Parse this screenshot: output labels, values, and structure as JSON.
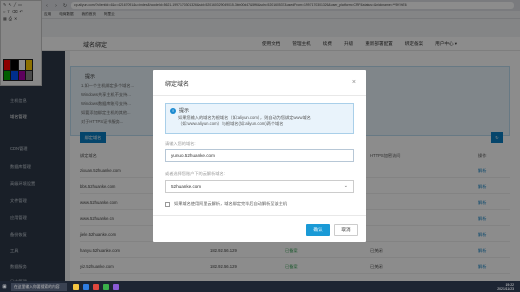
{
  "browser": {
    "url": "cp.aliyun.com/?clientId=4&c=42167091&u=index&hcodeId=5621-1997170301326&sid=520160329049015-3bb00d47&5ff6&sdn=520160537&usedFrom=1997170301326&user_platform=CRP&status=&nickname=**9K%E6",
    "bookmarks": [
      "应用",
      "电商数据",
      "我的首页",
      "阿里云"
    ]
  },
  "app": {
    "page_title": "域名绑定",
    "top_nav": [
      "使用文档",
      "管理主机",
      "续费",
      "升级",
      "重新部署配置",
      "绑定备案"
    ],
    "user_menu": "用户中心 ▾"
  },
  "sidebar": {
    "items": [
      "主机信息",
      "域名管理",
      "CDN管理",
      "数据库管理",
      "高级环境设置",
      "文件管理",
      "应用管理",
      "备份恢复",
      "工具",
      "数据服务",
      "日志管理"
    ]
  },
  "main": {
    "notice_title": "提示",
    "notice_lines": [
      "1.如一个主机绑定多个域名...",
      "Windows共享主机不支持...",
      "Windows数据库账号支持...",
      "如要添加绑定主机的其他...",
      "对于HTTPS证书服务..."
    ],
    "bind_button": "绑定域名",
    "table_headers": [
      "绑定域名",
      "",
      "",
      "HTTPS加密访问",
      "操作"
    ],
    "rows": [
      {
        "domain": "zixuan.52huanke.com",
        "ip": "",
        "status": "",
        "https": "",
        "action": "解析"
      },
      {
        "domain": "bbs.52huanke.com",
        "ip": "",
        "status": "",
        "https": "",
        "action": "解析"
      },
      {
        "domain": "www.52huanke.com",
        "ip": "",
        "status": "",
        "https": "",
        "action": "解析"
      },
      {
        "domain": "www.52huanke.cn",
        "ip": "",
        "status": "",
        "https": "",
        "action": "解析"
      },
      {
        "domain": "jiele.52huanke.com",
        "ip": "",
        "status": "",
        "https": "",
        "action": "解析"
      },
      {
        "domain": "hanyu.52huanke.com",
        "ip": "182.92.56.129",
        "status": "已备案",
        "https": "已关闭",
        "action": "解析"
      },
      {
        "domain": "yiz.52huanke.com",
        "ip": "182.92.56.129",
        "status": "已备案",
        "https": "已关闭",
        "action": "解析"
      }
    ]
  },
  "modal": {
    "title": "绑定域名",
    "tip_title": "提示",
    "tip_text": "如果您输入的域名为根域名（如:aliyun.com），则自动为您绑定www域名（如:www.aliyun.com）与根域名(如:aliyun.com)两个域名",
    "domain_label": "请输入您的域名:",
    "domain_value": "yunuo.52huanke.com",
    "select_label": "或者选择您账户下的云解析域名:",
    "select_value": "52huanke.com",
    "checkbox_label": "如果域名使用阿里云解析，域名绑定完毕后自动解析至该主机",
    "ok_label": "确认",
    "cancel_label": "取消"
  },
  "taskbar": {
    "search_placeholder": "在这里输入你要搜索的内容",
    "time": "19:22",
    "date": "2021/11/23"
  },
  "colors": {
    "accent": "#1a9ad6",
    "sidebar_bg": "#2f3a4a",
    "overlay": "rgba(0,0,0,0.45)"
  }
}
